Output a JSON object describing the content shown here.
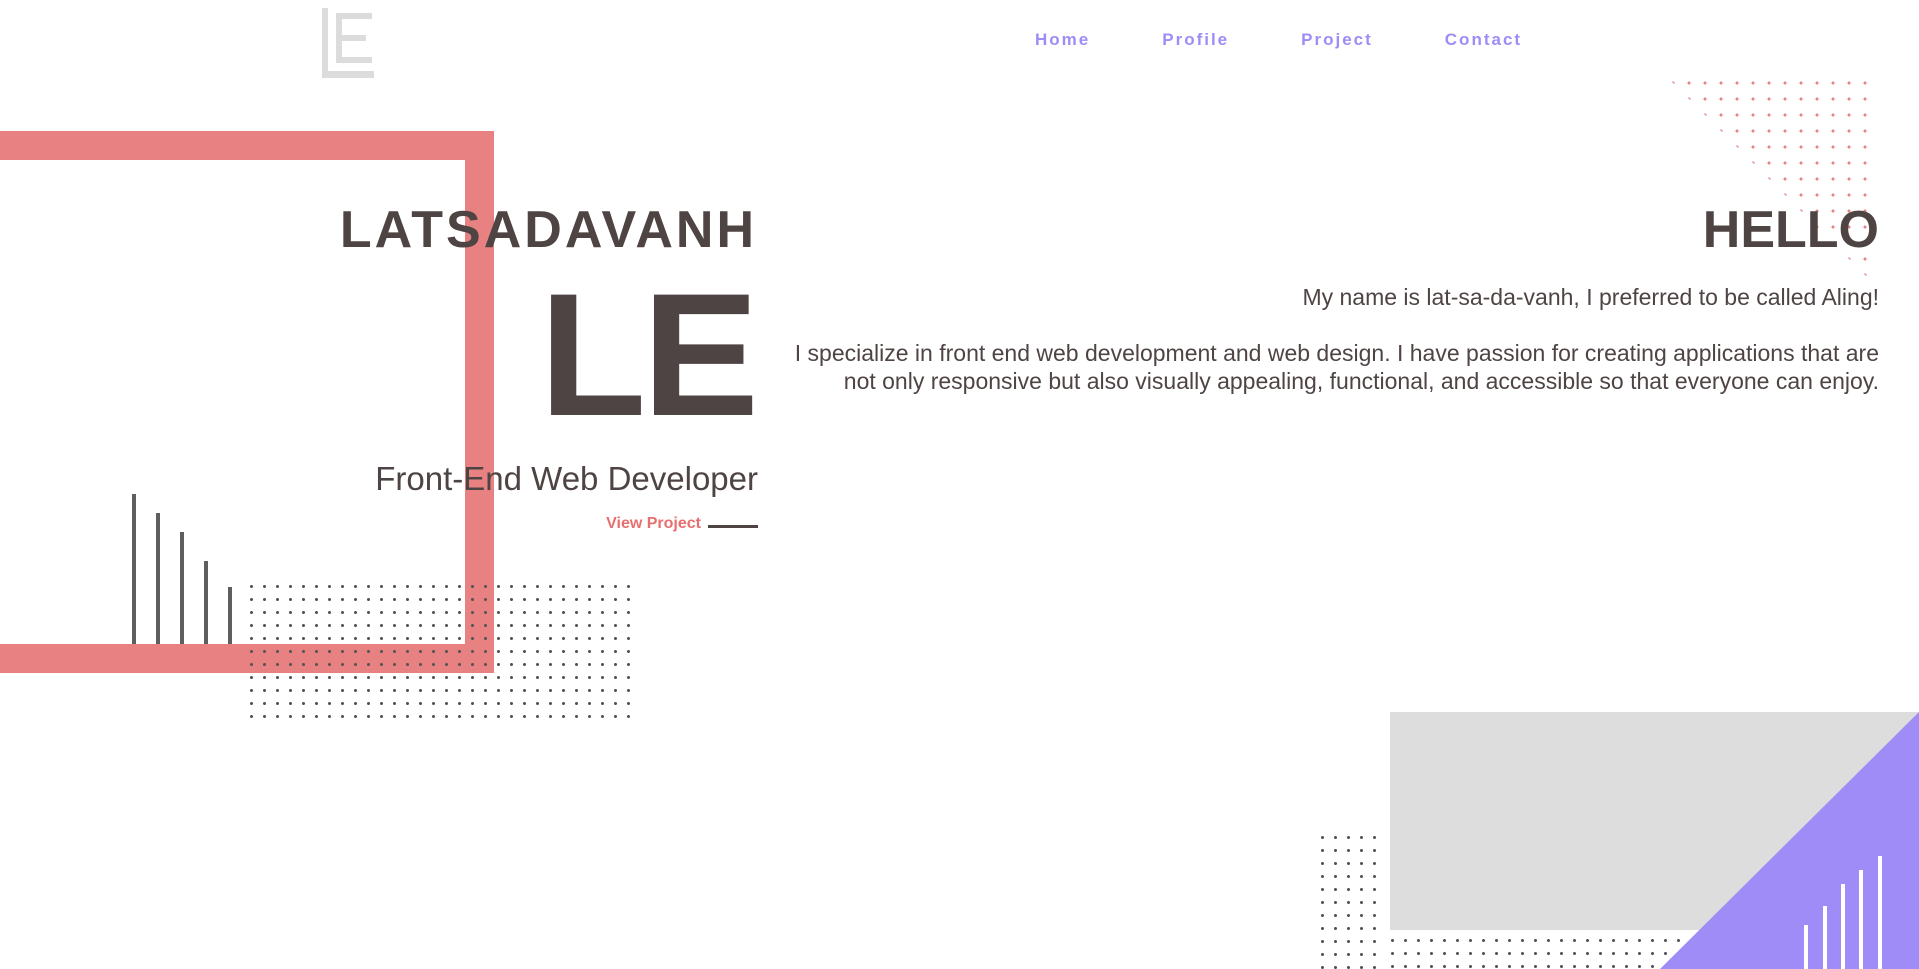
{
  "logo": {
    "text": "LE"
  },
  "nav": {
    "items": [
      {
        "label": "Home"
      },
      {
        "label": "Profile"
      },
      {
        "label": "Project"
      },
      {
        "label": "Contact"
      }
    ]
  },
  "hero": {
    "name": "LATSADAVANH",
    "initials": "LE",
    "role": "Front-End Web Developer",
    "view_project": "View Project"
  },
  "about": {
    "heading": "HELLO",
    "line1": "My name is lat-sa-da-vanh, I preferred to be called Aling!",
    "line2": "I specialize in front end web development and web design. I have passion for creating applications that are not only responsive but also visually appealing, functional, and accessible so that everyone can enjoy."
  },
  "colors": {
    "accent_coral": "#e88282",
    "accent_purple": "#a08cf6",
    "text_dark": "#4e4443",
    "block_gray": "#dddddd"
  }
}
